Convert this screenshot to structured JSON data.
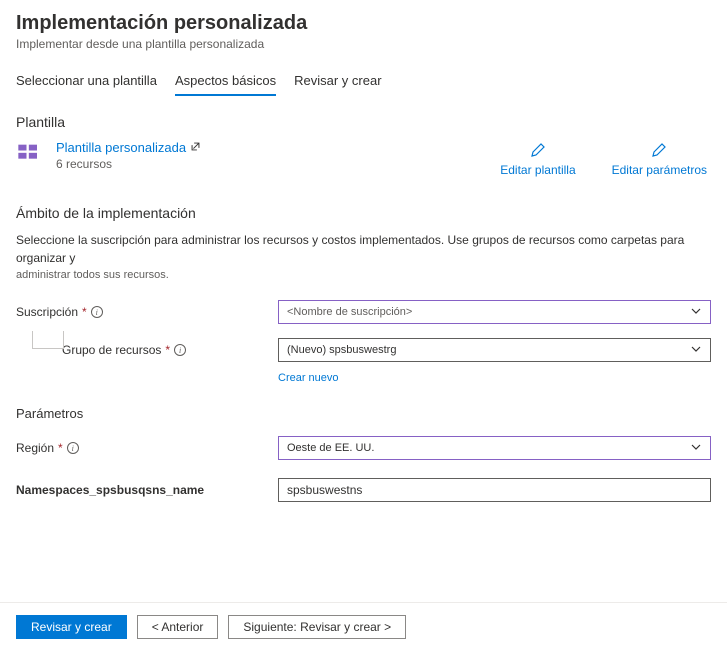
{
  "header": {
    "title": "Implementación personalizada",
    "subtitle": "Implementar desde una plantilla personalizada"
  },
  "tabs": {
    "t1": "Seleccionar una plantilla",
    "t2": "Aspectos básicos",
    "t3": "Revisar y crear"
  },
  "template": {
    "section": "Plantilla",
    "link": "Plantilla personalizada",
    "resources": "6 recursos",
    "edit_template": "Editar plantilla",
    "edit_params": "Editar parámetros"
  },
  "scope": {
    "heading": "Ámbito de la implementación",
    "line1": "Seleccione la suscripción para administrar los recursos y costos implementados. Use grupos de recursos como carpetas para organizar y",
    "line2": "administrar todos sus recursos."
  },
  "form": {
    "subscription_label": "Suscripción",
    "subscription_value": "<Nombre de suscripción>",
    "rg_label": "Grupo de recursos",
    "rg_value": "(Nuevo) spsbuswestrg",
    "create_new": "Crear nuevo"
  },
  "params": {
    "heading": "Parámetros",
    "region_label": "Región",
    "region_value": "Oeste de EE. UU.",
    "ns_label": "Namespaces_spsbusqsns_name",
    "ns_value": "spsbuswestns"
  },
  "footer": {
    "review_create": "Revisar y crear",
    "prev": "< Anterior",
    "next": "Siguiente: Revisar y crear >"
  }
}
